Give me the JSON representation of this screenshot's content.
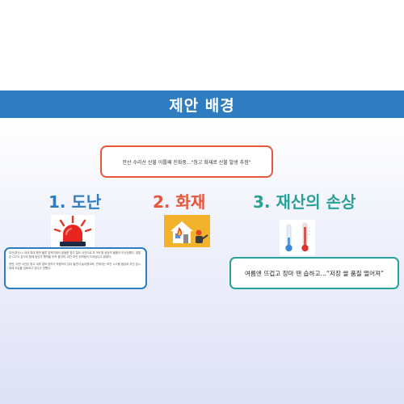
{
  "banner": {
    "title": "제안 배경"
  },
  "headline": "안산 수리산 산불 이틀째 진화중...\"창고 화재로 산불 발생 추정\"",
  "categories": [
    {
      "label": "1. 도난",
      "icon": "siren-icon",
      "color": "#2f7cc1"
    },
    {
      "label": "2. 화재",
      "icon": "house-fire-icon",
      "color": "#e8563a"
    },
    {
      "label": "3. 재산의 손상",
      "icon": "thermometer-icon",
      "color": "#2aa198"
    }
  ],
  "theft_article": {
    "para1": "부산/부산시: 국내 최대 항만 물류 집적지에서 발생한 창고 절도 사건으로 약 3억 원 상당의 물품이 도난당했다. 경찰은 CCTV 분석과 함께 범인의 행적을 추적 중이며, 야간 보안 취약점이 드러났다고 밝혔다.",
    "para2": "한편, 이번 사건은 창고 내부 경보 장치가 작동하지 않아 발견이 늦어졌으며, 관계자는 보안 시스템 점검과 무인 감시 체계 도입을 검토하고 있다고 전했다."
  },
  "damage_quote": "여름엔 뜨겁고 장마 땐 습하고…“저장 쌀 품질 떨어져”",
  "colors": {
    "banner": "#2f7cc1",
    "fire": "#e8563a",
    "damage": "#2aa198"
  }
}
